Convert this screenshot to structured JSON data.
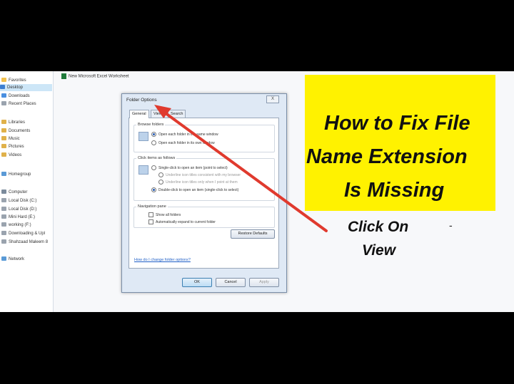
{
  "explorer": {
    "file_name": "New Microsoft Excel Worksheet",
    "nav": [
      {
        "label": "Favorites",
        "color": "#f2c14e",
        "selected": false
      },
      {
        "label": "Desktop",
        "color": "#3d7fd1",
        "selected": true
      },
      {
        "label": "Downloads",
        "color": "#4a8fe0",
        "selected": false
      },
      {
        "label": "Recent Places",
        "color": "#9aa3ae",
        "selected": false
      },
      {
        "label": "Libraries",
        "color": "#e0b14a",
        "selected": false
      },
      {
        "label": "Documents",
        "color": "#e0b14a",
        "selected": false
      },
      {
        "label": "Music",
        "color": "#e0b14a",
        "selected": false
      },
      {
        "label": "Pictures",
        "color": "#e0b14a",
        "selected": false
      },
      {
        "label": "Videos",
        "color": "#e0b14a",
        "selected": false
      },
      {
        "label": "Homegroup",
        "color": "#5a9ad6",
        "selected": false
      },
      {
        "label": "Computer",
        "color": "#7c8b9c",
        "selected": false
      },
      {
        "label": "Local Disk (C:)",
        "color": "#9aa3ae",
        "selected": false
      },
      {
        "label": "Local Disk (D:)",
        "color": "#9aa3ae",
        "selected": false
      },
      {
        "label": "Mini Hard (E:)",
        "color": "#9aa3ae",
        "selected": false
      },
      {
        "label": "working (F:)",
        "color": "#9aa3ae",
        "selected": false
      },
      {
        "label": "Downloading & Upl",
        "color": "#9aa3ae",
        "selected": false
      },
      {
        "label": "Shahzaad Maleem 8",
        "color": "#9aa3ae",
        "selected": false
      },
      {
        "label": "Network",
        "color": "#5a9ad6",
        "selected": false
      }
    ]
  },
  "dialog": {
    "title": "Folder Options",
    "close": "X",
    "tabs": [
      "General",
      "View",
      "Search"
    ],
    "browse_folders": {
      "label": "Browse folders",
      "options": [
        "Open each folder in the same window",
        "Open each folder in its own window"
      ]
    },
    "click_items": {
      "label": "Click items as follows",
      "options": [
        "Single-click to open an item (point to select)",
        "Underline icon titles consistent with my browser",
        "Underline icon titles only when I point at them",
        "Double-click to open an item (single-click to select)"
      ]
    },
    "navigation_pane": {
      "label": "Navigation pane",
      "options": [
        "Show all folders",
        "Automatically expand to current folder"
      ]
    },
    "restore_button": "Restore Defaults",
    "help_link": "How do I change folder options?",
    "ok": "OK",
    "cancel": "Cancel",
    "apply": "Apply"
  },
  "banner": {
    "lines": [
      "How to Fix File",
      "Name Extension",
      "Is Missing"
    ],
    "background": "#fff200"
  },
  "caption": {
    "line1": "Click On",
    "line2": "View",
    "dash": "-"
  },
  "arrow_color": "#e03a2e"
}
